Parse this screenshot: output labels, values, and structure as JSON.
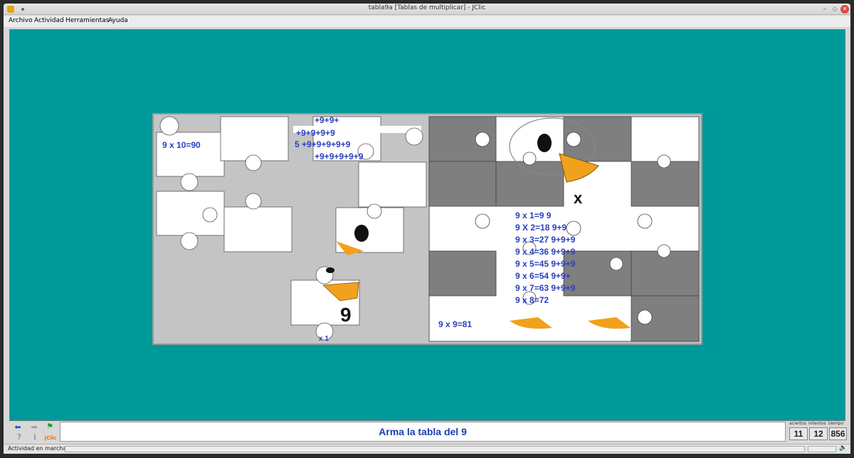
{
  "window": {
    "title": "tabla9a [Tablas de multiplicar] - JClic",
    "app_icon": "jclic-app-icon",
    "controls": [
      "minimize-icon",
      "maximize-icon",
      "close-icon"
    ]
  },
  "menu": {
    "items": [
      {
        "label": "Archivo"
      },
      {
        "label": "Actividad"
      },
      {
        "label": "Herramientas"
      },
      {
        "label": "Ayuda"
      }
    ]
  },
  "puzzle": {
    "left_texts": [
      "9 x 10=90",
      "+9+9+",
      "+9+9+9+9",
      "5 +9+9+9+9+9",
      "+9+9+9+9+9",
      "9",
      "x 1"
    ],
    "right_texts": [
      "9 x 1=9   9",
      "9 X 2=18 9+9",
      "9 x 3=27 9+9+9",
      "9 x 4=36 9+9+9",
      "9 x 5=45 9+9+9",
      "9 x 6=54 9+9+",
      "9 x 7=63 9+9+9",
      "9 x 8=72",
      "9 x 9=81"
    ],
    "colors": {
      "background": "#00999a",
      "text": "#2a3fbf",
      "beak": "#f2a11c",
      "dark_piece": "#7f7f7f"
    }
  },
  "bottom": {
    "message": "Arma la tabla del 9",
    "buttons": {
      "prev": "arrow-left-icon",
      "next": "arrow-right-icon",
      "flag": "green-flag-icon",
      "help": "question-icon",
      "info": "info-icon",
      "jclic": "JClic"
    },
    "counters": {
      "aciertos_label": "aciertos",
      "intentos_label": "intentos",
      "tiempo_label": "tiempo",
      "aciertos": "11",
      "intentos": "12",
      "tiempo": "856"
    }
  },
  "status": {
    "text": "Actividad en marcha",
    "sound_icon": "speaker-icon"
  }
}
